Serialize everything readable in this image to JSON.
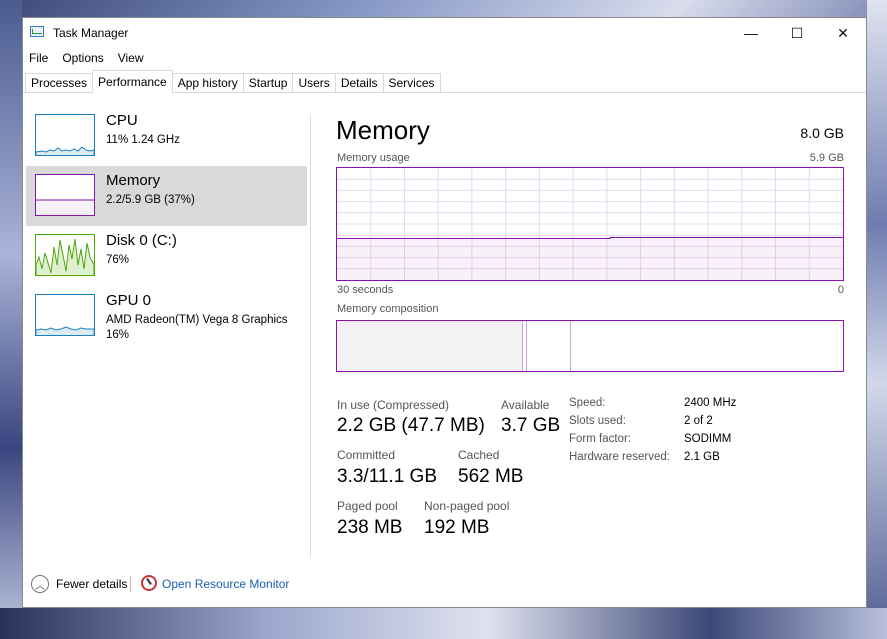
{
  "window": {
    "title": "Task Manager",
    "controls": {
      "minimize": "—",
      "maximize": "☐",
      "close": "✕"
    }
  },
  "menu": [
    "File",
    "Options",
    "View"
  ],
  "tabs": [
    {
      "label": "Processes",
      "active": false
    },
    {
      "label": "Performance",
      "active": true
    },
    {
      "label": "App history",
      "active": false
    },
    {
      "label": "Startup",
      "active": false
    },
    {
      "label": "Users",
      "active": false
    },
    {
      "label": "Details",
      "active": false
    },
    {
      "label": "Services",
      "active": false
    }
  ],
  "sidebar": {
    "items": [
      {
        "title": "CPU",
        "line1": "11%  1.24 GHz",
        "line2": "",
        "color": "#1c7fbf",
        "selected": false
      },
      {
        "title": "Memory",
        "line1": "2.2/5.9 GB (37%)",
        "line2": "",
        "color": "#8b12ae",
        "selected": true
      },
      {
        "title": "Disk 0 (C:)",
        "line1": "76%",
        "line2": "",
        "color": "#4da60c",
        "selected": false
      },
      {
        "title": "GPU 0",
        "line1": "AMD Radeon(TM) Vega 8 Graphics",
        "line2": "16%",
        "color": "#1c7fbf",
        "selected": false
      }
    ]
  },
  "memory": {
    "title": "Memory",
    "total": "8.0 GB",
    "usage_label": "Memory usage",
    "usage_max": "5.9 GB",
    "time_left": "30 seconds",
    "time_right": "0",
    "composition_label": "Memory composition",
    "usage_level": 0.37,
    "stats": {
      "in_use_label": "In use (Compressed)",
      "in_use": "2.2 GB (47.7 MB)",
      "available_label": "Available",
      "available": "3.7 GB",
      "committed_label": "Committed",
      "committed": "3.3/11.1 GB",
      "cached_label": "Cached",
      "cached": "562 MB",
      "paged_label": "Paged pool",
      "paged": "238 MB",
      "nonpaged_label": "Non-paged pool",
      "nonpaged": "192 MB"
    },
    "properties": [
      {
        "k": "Speed:",
        "v": "2400 MHz"
      },
      {
        "k": "Slots used:",
        "v": "2 of 2"
      },
      {
        "k": "Form factor:",
        "v": "SODIMM"
      },
      {
        "k": "Hardware reserved:",
        "v": "2.1 GB"
      }
    ]
  },
  "footer": {
    "fewer_details": "Fewer details",
    "resource_monitor": "Open Resource Monitor"
  }
}
